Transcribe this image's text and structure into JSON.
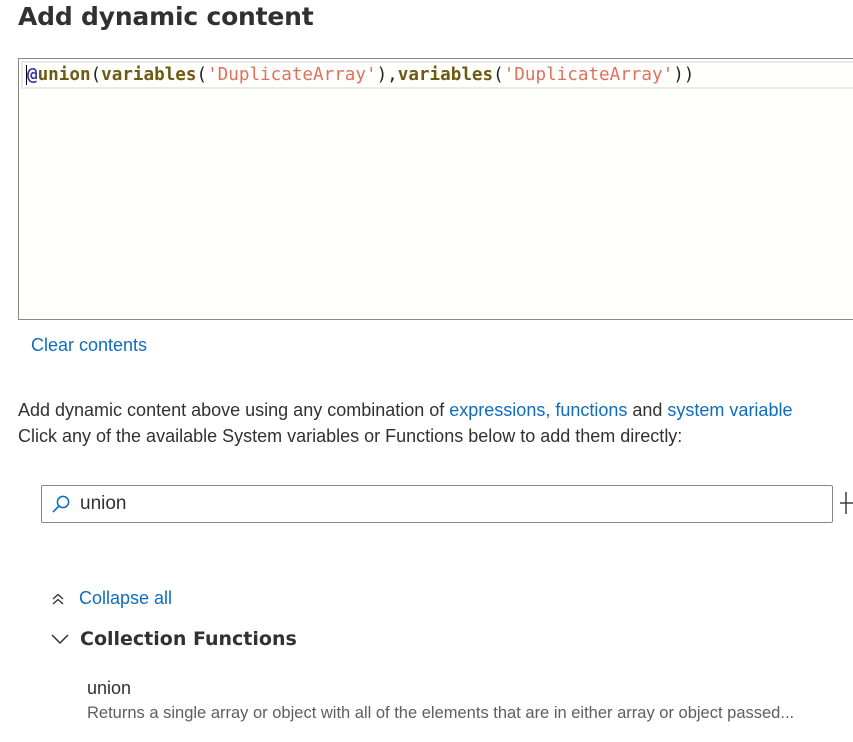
{
  "dialog": {
    "title": "Add dynamic content"
  },
  "editor": {
    "tokens": {
      "at": "@",
      "fn_union": "union",
      "open1": "(",
      "fn_var1": "variables",
      "open2": "(",
      "str1": "'DuplicateArray'",
      "close2": "),",
      "fn_var2": "variables",
      "open3": "(",
      "str2": "'DuplicateArray'",
      "close3": "))"
    }
  },
  "clear_label": "Clear contents",
  "help": {
    "line1_prefix": "Add dynamic content above using any combination of ",
    "link1": "expressions, functions",
    "line1_mid": " and ",
    "link2": "system variable",
    "line2": "Click any of the available System variables or Functions below to add them directly:"
  },
  "search": {
    "value": "union",
    "icon": "search-icon"
  },
  "collapse_label": "Collapse all",
  "group": {
    "label": "Collection Functions"
  },
  "functions": [
    {
      "name": "union",
      "description": "Returns a single array or object with all of the elements that are in either array or object passed..."
    }
  ],
  "colors": {
    "link": "#0f6cbd",
    "string_token": "#e27059",
    "function_token": "#6e5b12",
    "at_token": "#3a3aa8"
  }
}
